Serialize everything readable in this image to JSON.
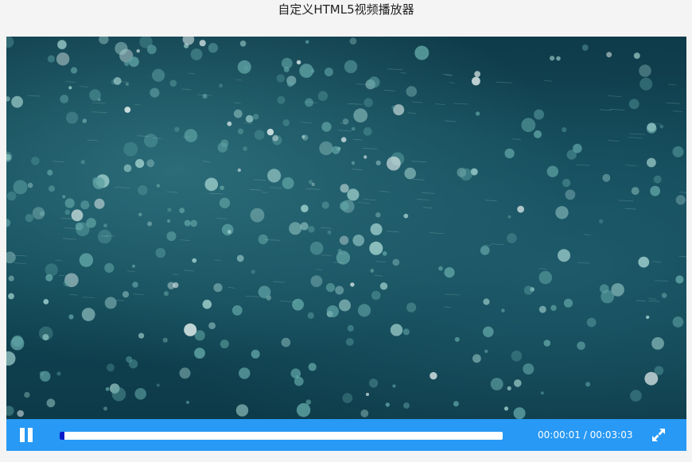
{
  "page": {
    "title": "自定义HTML5视频播放器"
  },
  "player": {
    "state": "playing",
    "progress_fraction": 0.005,
    "current_time": "00:00:01",
    "separator": " / ",
    "duration": "00:03:03",
    "colors": {
      "control_bar": "#2899f5",
      "progress_track": "#ffffff",
      "progress_fill": "#0a1cc8"
    },
    "icons": {
      "play_state": "pause-icon",
      "fullscreen": "expand-icon"
    }
  }
}
